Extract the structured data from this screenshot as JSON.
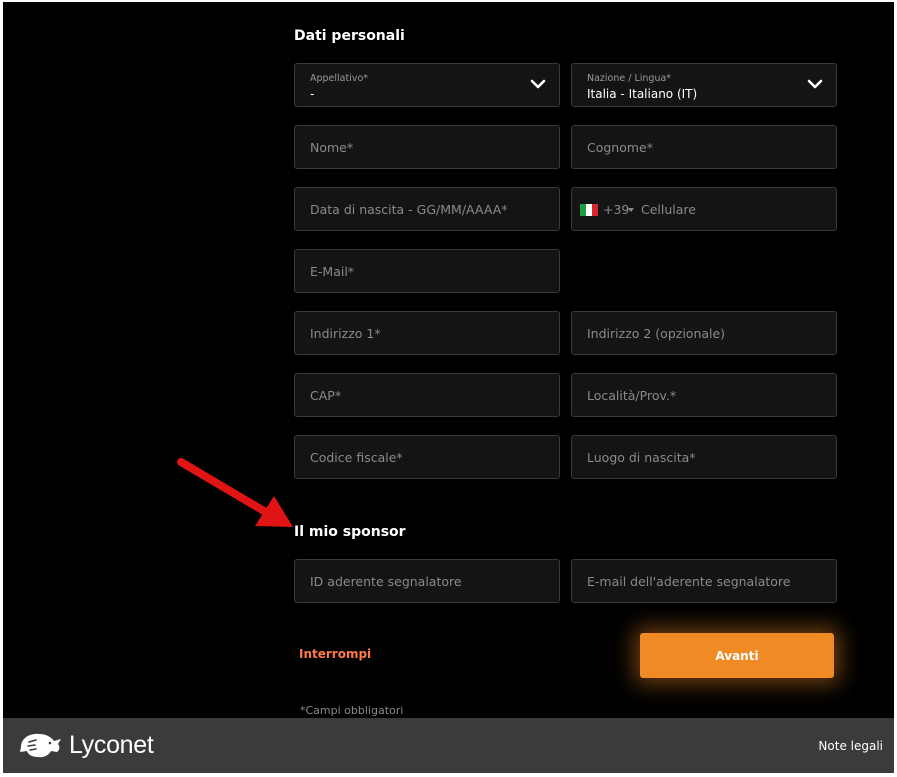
{
  "personal": {
    "title": "Dati personali",
    "salutation": {
      "label": "Appellativo*",
      "value": "-"
    },
    "country_language": {
      "label": "Nazione / Lingua*",
      "value": "Italia - Italiano (IT)"
    },
    "first_name_placeholder": "Nome*",
    "last_name_placeholder": "Cognome*",
    "birth_date_placeholder": "Data di nascita - GG/MM/AAAA*",
    "phone": {
      "prefix": "+39",
      "placeholder": "Cellulare"
    },
    "email_placeholder": "E-Mail*",
    "address1_placeholder": "Indirizzo 1*",
    "address2_placeholder": "Indirizzo 2 (opzionale)",
    "zip_placeholder": "CAP*",
    "city_placeholder": "Località/Prov.*",
    "tax_code_placeholder": "Codice fiscale*",
    "birth_place_placeholder": "Luogo di nascita*"
  },
  "sponsor": {
    "title": "Il mio sponsor",
    "id_placeholder": "ID aderente segnalatore",
    "email_placeholder": "E-mail dell'aderente segnalatore"
  },
  "actions": {
    "cancel_label": "Interrompi",
    "next_label": "Avanti"
  },
  "required_note": "*Campi obbligatori",
  "footer": {
    "logo_text": "Lyconet",
    "legal_label": "Note legali"
  },
  "colors": {
    "accent": "#f08a24",
    "cancel": "#ff7a45",
    "annotation_arrow": "#e01414"
  }
}
